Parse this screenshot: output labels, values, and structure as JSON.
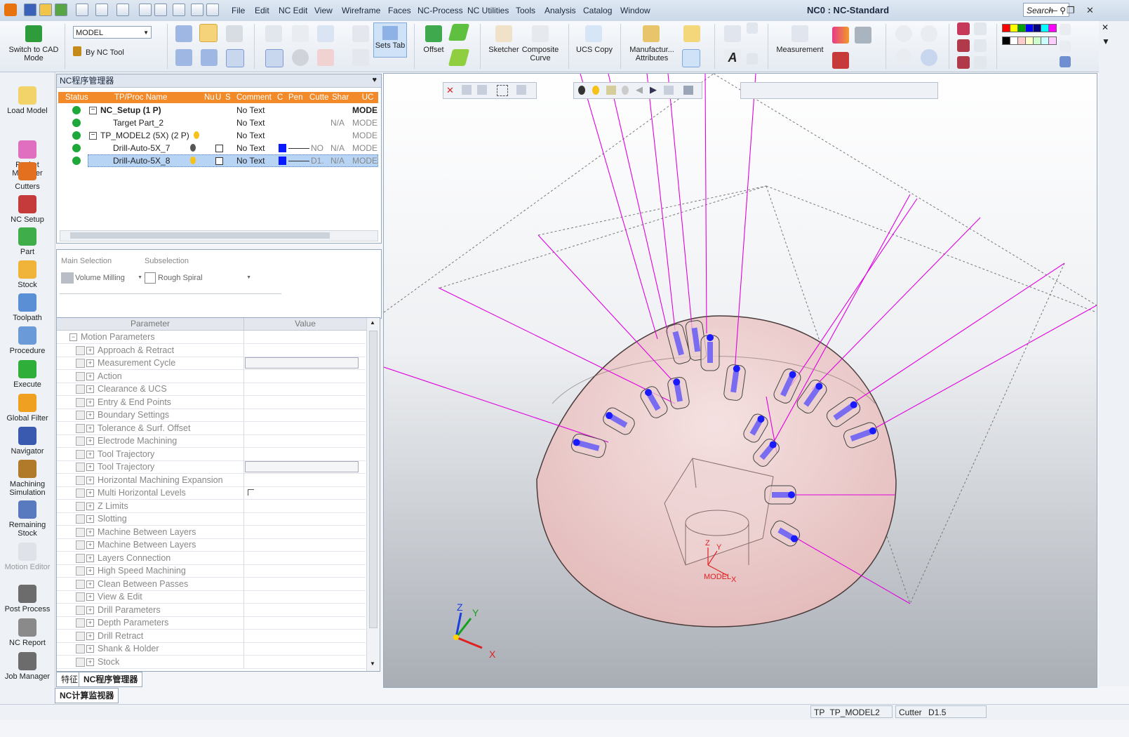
{
  "title_bar": {
    "app_icon": "app-logo-icon",
    "menus": [
      "File",
      "Edit",
      "NC Edit",
      "View",
      "Wireframe",
      "Faces",
      "NC-Process",
      "NC Utilities",
      "Tools",
      "Analysis",
      "Catalog",
      "Window"
    ],
    "window_title": "NC0 : NC-Standard",
    "search_label": "Search"
  },
  "ribbon": {
    "switch_label": "Switch to CAD Mode",
    "model_select": "MODEL",
    "by_nc_tool": "By NC Tool",
    "sets_tab": "Sets Tab",
    "offset": "Offset",
    "sketcher": "Sketcher",
    "composite_curve": "Composite Curve",
    "ucs_copy": "UCS Copy",
    "manufacturing_attributes": "Manufactur... Attributes",
    "measurement": "Measurement",
    "palette_colors": [
      "#ff0000",
      "#ffff00",
      "#00a000",
      "#0000ff",
      "#000080",
      "#00ffff",
      "#ff00ff",
      "#000000",
      "#ffffff",
      "#ffcccc",
      "#ffffcc",
      "#ccffcc",
      "#ccffff",
      "#ffccff"
    ]
  },
  "left_toolbar": [
    {
      "label": "Load Model",
      "icon": "load-model-icon"
    },
    {
      "label": "Pocket Manager",
      "icon": "pocket-manager-icon"
    },
    {
      "label": "Cutters",
      "icon": "cutters-icon"
    },
    {
      "label": "NC Setup",
      "icon": "nc-setup-icon"
    },
    {
      "label": "Part",
      "icon": "part-icon"
    },
    {
      "label": "Stock",
      "icon": "stock-icon"
    },
    {
      "label": "Toolpath",
      "icon": "toolpath-icon"
    },
    {
      "label": "Procedure",
      "icon": "procedure-icon"
    },
    {
      "label": "Execute",
      "icon": "execute-icon"
    },
    {
      "label": "Global Filter",
      "icon": "global-filter-icon"
    },
    {
      "label": "Navigator",
      "icon": "navigator-icon"
    },
    {
      "label": "Machining Simulation",
      "icon": "machining-simulation-icon"
    },
    {
      "label": "Remaining Stock",
      "icon": "remaining-stock-icon"
    },
    {
      "label": "Motion Editor",
      "icon": "motion-editor-icon"
    },
    {
      "label": "Post Process",
      "icon": "post-process-icon"
    },
    {
      "label": "NC Report",
      "icon": "nc-report-icon"
    },
    {
      "label": "Job Manager",
      "icon": "job-manager-icon"
    }
  ],
  "nc_manager": {
    "title": "NC程序管理器",
    "columns": [
      "Status",
      "TP/Proc Name",
      "Nu",
      "U",
      "S",
      "Comment",
      "C",
      "Pen",
      "Cutte",
      "Shar",
      "UC"
    ],
    "rows": [
      {
        "name": "NC_Setup (1 P)",
        "comment": "No Text",
        "cutter": "",
        "shar": "",
        "uc": "MODE",
        "bold": true,
        "selected": false
      },
      {
        "name": "Target Part_2",
        "comment": "No Text",
        "cutter": "",
        "shar": "N/A",
        "uc": "MODE",
        "bold": false,
        "selected": false
      },
      {
        "name": "TP_MODEL2 (5X) (2 P)",
        "comment": "No Text",
        "cutter": "",
        "shar": "",
        "uc": "MODE",
        "bold": false,
        "selected": false
      },
      {
        "name": "Drill-Auto-5X_7",
        "comment": "No Text",
        "cutter": "NO",
        "shar": "N/A",
        "uc": "MODE",
        "bold": false,
        "selected": false
      },
      {
        "name": "Drill-Auto-5X_8",
        "comment": "No Text",
        "cutter": "D1.",
        "shar": "N/A",
        "uc": "MODE",
        "bold": false,
        "selected": true
      }
    ]
  },
  "selection": {
    "main_label": "Main Selection",
    "main_value": "Volume Milling",
    "sub_label": "Subselection",
    "sub_value": "Rough Spiral"
  },
  "parameters": {
    "col_parameter": "Parameter",
    "col_value": "Value",
    "group": "Motion Parameters",
    "items": [
      "Approach & Retract",
      "Measurement Cycle",
      "Action",
      "Clearance & UCS",
      "Entry & End Points",
      "Boundary Settings",
      "Tolerance & Surf. Offset",
      "Electrode Machining",
      "Tool Trajectory",
      "Tool Trajectory",
      "Horizontal Machining Expansion",
      "Multi Horizontal Levels",
      "Z Limits",
      "Slotting",
      "Machine Between Layers",
      "Machine Between Layers",
      "Layers Connection",
      "High Speed Machining",
      "Clean Between Passes",
      "View & Edit",
      "Drill Parameters",
      "Depth Parameters",
      "Drill Retract",
      "Shank & Holder",
      "Stock"
    ]
  },
  "bottom_tabs": [
    "特征",
    "NC程序管理器"
  ],
  "monitor_tab": "NC计算监视器",
  "viewport": {
    "axis_labels": {
      "x": "X",
      "y": "Y",
      "z": "Z"
    },
    "model_ucs_label": "MODEL",
    "accent_toolpath": "#e000e0",
    "dome_color": "#e7c2c2"
  },
  "status": {
    "tp": "TP",
    "tp_value": "TP_MODEL2",
    "cutter": "Cutter",
    "cutter_value": "D1.5"
  }
}
